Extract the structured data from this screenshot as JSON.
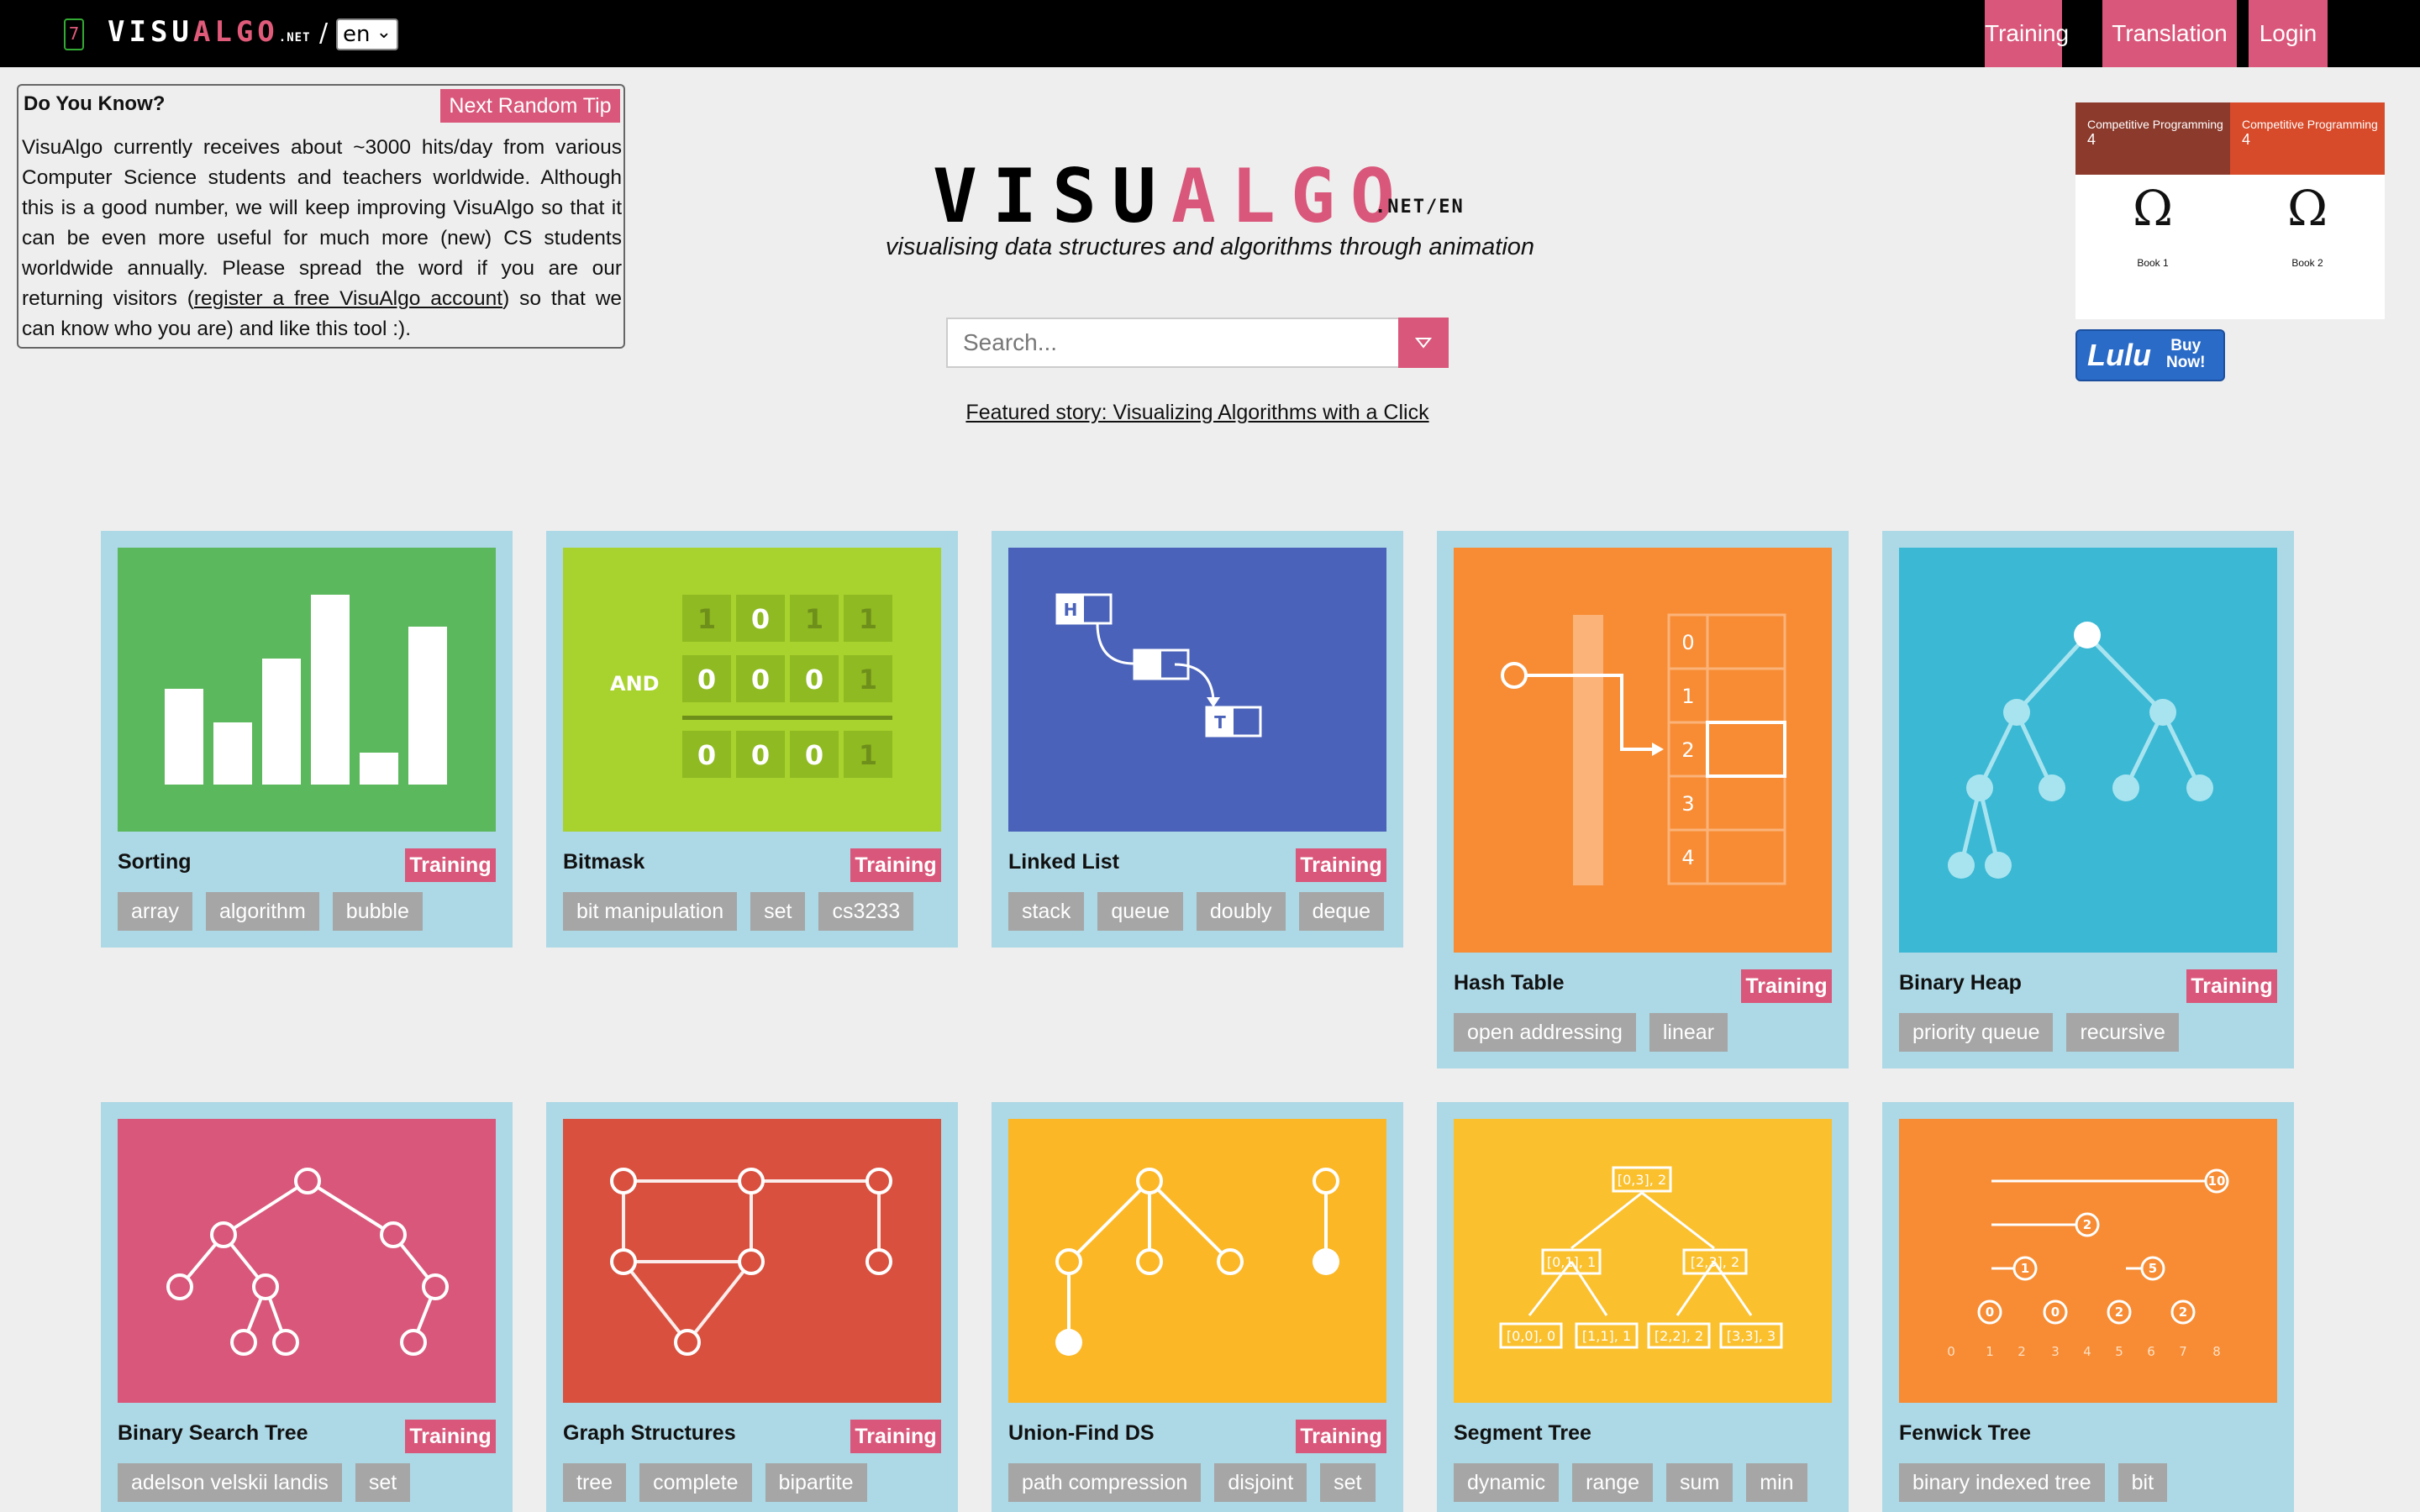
{
  "nav": {
    "logo_main": "VISU",
    "logo_accent": "ALGO",
    "logo_suffix": ".NET",
    "slash": "/",
    "language": "en",
    "mini_icon_label": "7",
    "buttons": [
      "Training",
      "Translation",
      "Login"
    ]
  },
  "tip": {
    "title": "Do You Know?",
    "button": "Next Random Tip",
    "text_before": "VisuAlgo currently receives about ~3000 hits/day from various Computer Science students and teachers worldwide. Although this is a good number, we will keep improving VisuAlgo so that it can be even more useful for much more (new) CS students worldwide annually. Please spread the word if you are our returning visitors (",
    "link": "register a free VisuAlgo account",
    "text_after": " so that we can know who you are) and like this tool :)."
  },
  "header": {
    "logo_main": "VISU",
    "logo_accent": "ALGO",
    "logo_suffix": ".NET/EN",
    "tagline": "visualising data structures and algorithms through animation"
  },
  "search": {
    "placeholder": "Search..."
  },
  "featured": "Featured story: Visualizing Algorithms with a Click",
  "books": [
    {
      "series": "Competitive Programming",
      "edition": "4",
      "label": "Book 1"
    },
    {
      "series": "Competitive Programming",
      "edition": "4",
      "label": "Book 2"
    }
  ],
  "lulu": {
    "brand": "Lulu",
    "cta_line1": "Buy",
    "cta_line2": "Now!"
  },
  "cards": [
    {
      "title": "Sorting",
      "training": "Training",
      "tags": [
        "array",
        "algorithm",
        "bubble"
      ],
      "color": "#5cb85c"
    },
    {
      "title": "Bitmask",
      "training": "Training",
      "tags": [
        "bit manipulation",
        "set",
        "cs3233"
      ],
      "color": "#a8d22d",
      "art": {
        "op": "AND",
        "rows": [
          [
            "1",
            "0",
            "1",
            "1"
          ],
          [
            "0",
            "0",
            "0",
            "1"
          ],
          [
            "0",
            "0",
            "0",
            "1"
          ]
        ]
      }
    },
    {
      "title": "Linked List",
      "training": "Training",
      "tags": [
        "stack",
        "queue",
        "doubly",
        "deque"
      ],
      "color": "#4a62ba",
      "art": {
        "head": "H",
        "tail": "T"
      }
    },
    {
      "title": "Hash Table",
      "training": "Training",
      "tags": [
        "open addressing",
        "linear"
      ],
      "color": "#f78c34",
      "art": {
        "slots": [
          "0",
          "1",
          "2",
          "3",
          "4"
        ]
      }
    },
    {
      "title": "Binary Heap",
      "training": "Training",
      "tags": [
        "priority queue",
        "recursive"
      ],
      "color": "#3bb8d4"
    },
    {
      "title": "Binary Search Tree",
      "training": "Training",
      "tags": [
        "adelson velskii landis",
        "set"
      ],
      "color": "#d9577a"
    },
    {
      "title": "Graph Structures",
      "training": "Training",
      "tags": [
        "tree",
        "complete",
        "bipartite"
      ],
      "color": "#d9503f"
    },
    {
      "title": "Union-Find DS",
      "training": "Training",
      "tags": [
        "path compression",
        "disjoint",
        "set"
      ],
      "color": "#fbb726"
    },
    {
      "title": "Segment Tree",
      "training": "",
      "tags": [
        "dynamic",
        "range",
        "sum",
        "min"
      ],
      "color": "#fbc02d",
      "art": {
        "nodes": [
          "[0,3], 2",
          "[0,1], 1",
          "[2,3], 2",
          "[0,0], 0",
          "[1,1], 1",
          "[2,2], 2",
          "[3,3], 3"
        ]
      }
    },
    {
      "title": "Fenwick Tree",
      "training": "",
      "tags": [
        "binary indexed tree",
        "bit"
      ],
      "color": "#f78c34",
      "art": {
        "values": [
          "10",
          "2",
          "1",
          "5",
          "0",
          "0",
          "2",
          "2"
        ],
        "axis": [
          "0",
          "1",
          "2",
          "3",
          "4",
          "5",
          "6",
          "7",
          "8"
        ]
      }
    }
  ]
}
